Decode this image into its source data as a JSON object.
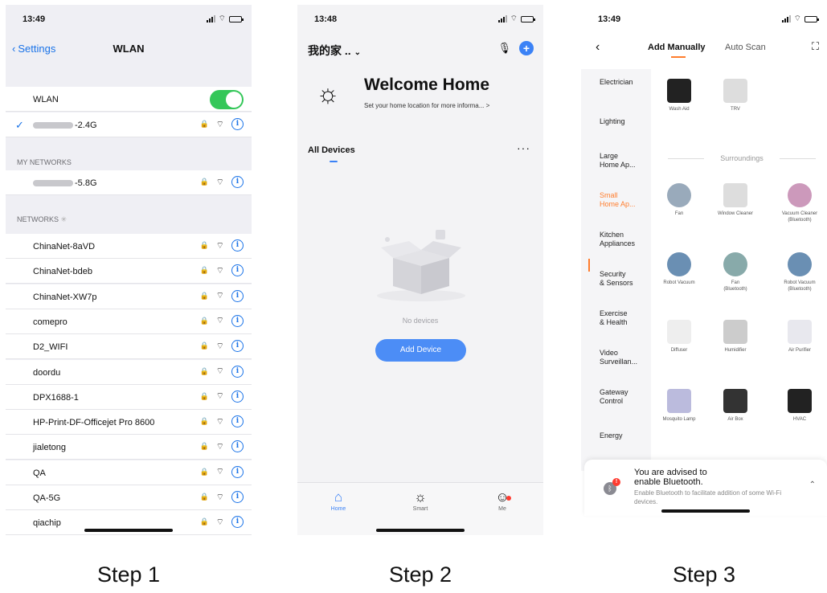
{
  "steps": [
    "Step 1",
    "Step 2",
    "Step 3"
  ],
  "phone1": {
    "time": "13:49",
    "back_label": "Settings",
    "title": "WLAN",
    "wlan_label": "WLAN",
    "connected": "-2.4G",
    "my_networks_header": "MY NETWORKS",
    "my_network": "-5.8G",
    "networks_header": "NETWORKS",
    "networks": [
      "ChinaNet-8aVD",
      "ChinaNet-bdeb",
      "ChinaNet-XW7p",
      "comepro",
      "D2_WIFI",
      "doordu",
      "DPX1688-1",
      "HP-Print-DF-Officejet Pro 8600",
      "jialetong",
      "QA",
      "QA-5G",
      "qiachip"
    ]
  },
  "phone2": {
    "time": "13:48",
    "home_name": "我的家 ..",
    "welcome": "Welcome Home",
    "location_hint": "Set your home location for more informa...",
    "all_devices": "All Devices",
    "no_devices": "No devices",
    "add_device": "Add Device",
    "tabs": [
      "Home",
      "Smart",
      "Me"
    ]
  },
  "phone3": {
    "time": "13:49",
    "tab_manual": "Add Manually",
    "tab_auto": "Auto Scan",
    "categories": [
      [
        "Electrician"
      ],
      [
        "Lighting"
      ],
      [
        "Large",
        "Home Ap..."
      ],
      [
        "Small",
        "Home Ap..."
      ],
      [
        "Kitchen",
        "Appliances"
      ],
      [
        "Security",
        "& Sensors"
      ],
      [
        "Exercise",
        "& Health"
      ],
      [
        "Video",
        "Surveillan..."
      ],
      [
        "Gateway",
        "Control"
      ],
      [
        "Energy"
      ]
    ],
    "top_items": [
      "Wash Aid",
      "TRV"
    ],
    "section": "Surroundings",
    "items": [
      [
        "Fan"
      ],
      [
        "Window Cleaner"
      ],
      [
        "Vacuum Cleaner",
        "(Bluetooth)"
      ],
      [
        "Robot Vacuum"
      ],
      [
        "Fan",
        "(Bluetooth)"
      ],
      [
        "Robot Vacuum",
        "(Bluetooth)"
      ],
      [
        "Diffuser"
      ],
      [
        "Humidifier"
      ],
      [
        "Air Purifier"
      ],
      [
        "Mosquito Lamp"
      ],
      [
        "Air Box"
      ],
      [
        "HVAC"
      ]
    ],
    "bt_title_1": "You are advised to",
    "bt_title_2": "enable Bluetooth.",
    "bt_desc": "Enable Bluetooth to facilitate addition of some Wi-Fi devices."
  }
}
